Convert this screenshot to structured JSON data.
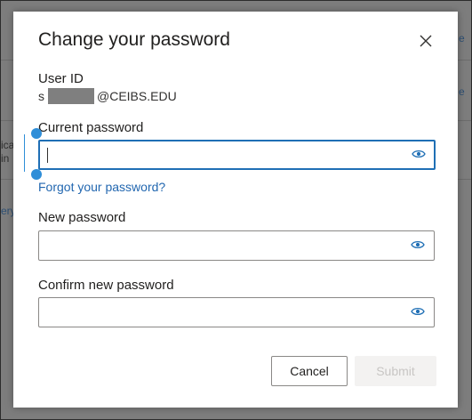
{
  "background": {
    "fragments": [
      "e",
      "e",
      "ica",
      "in",
      "ery"
    ]
  },
  "dialog": {
    "title": "Change your password",
    "close_icon": "close-icon",
    "user_id": {
      "label": "User ID",
      "value_prefix": "s",
      "value_suffix": "@CEIBS.EDU"
    },
    "current_password": {
      "label": "Current password",
      "value": "",
      "placeholder": "",
      "icon": "eye-icon"
    },
    "forgot_link": "Forgot your password?",
    "new_password": {
      "label": "New password",
      "value": "",
      "placeholder": "",
      "icon": "eye-icon"
    },
    "confirm_password": {
      "label": "Confirm new password",
      "value": "",
      "placeholder": "",
      "icon": "eye-icon"
    },
    "buttons": {
      "cancel": "Cancel",
      "submit": "Submit"
    }
  },
  "colors": {
    "accent": "#1f6fb5",
    "link": "#2267b0",
    "overlay": "#7d7d7d",
    "disabled_text": "#c8c6c4"
  }
}
